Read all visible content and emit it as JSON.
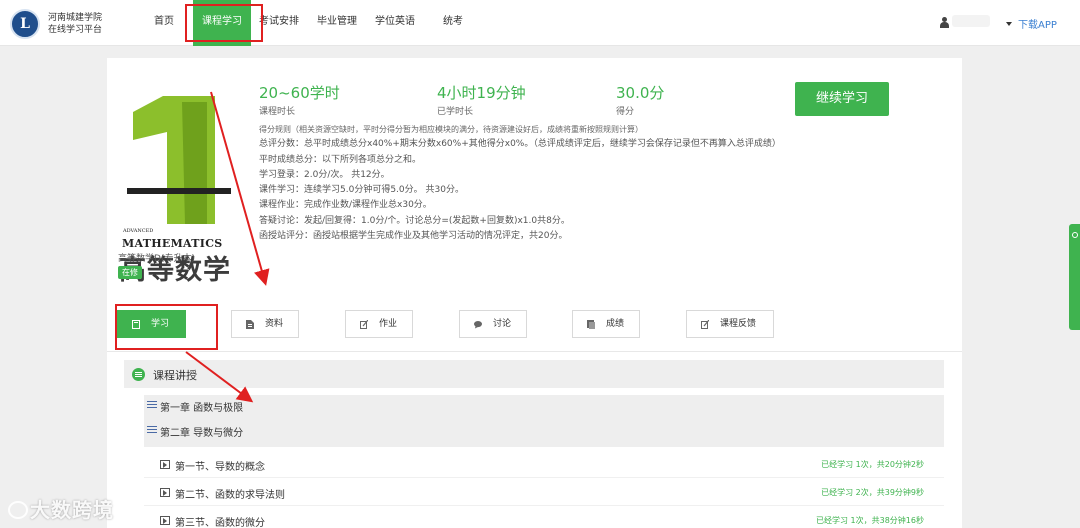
{
  "header": {
    "org_name": "河南城建学院",
    "org_sub": "在线学习平台",
    "nav": [
      {
        "label": "首页"
      },
      {
        "label": "课程学习"
      },
      {
        "label": "考试安排"
      },
      {
        "label": "毕业管理"
      },
      {
        "label": "学位英语"
      },
      {
        "label": "统考"
      }
    ],
    "active_nav": "课程学习",
    "download_app": "下载APP"
  },
  "course": {
    "cover_adv": "ADVANCED",
    "cover_math": "MATHEMATICS",
    "cover_title": "高等数学",
    "name": "高等数学D(专升本)",
    "status_badge": "在修",
    "stats": [
      {
        "value": "20~60学时",
        "label": "课程时长"
      },
      {
        "value": "4小时19分钟",
        "label": "已学时长"
      },
      {
        "value": "30.0分",
        "label": "得分"
      }
    ],
    "continue_label": "继续学习",
    "rules": [
      "得分规则（相关资源空缺时，平时分得分暂为相应模块的满分，待资源建设好后，成绩将重新按照规则计算）",
      "总评分数：总平时成绩总分x40%+期末分数x60%+其他得分x0%。（总评成绩评定后，继续学习会保存记录但不再算入总评成绩）",
      "平时成绩总分：以下所列各项总分之和。",
      "学习登录：2.0分/次。 共12分。",
      "课件学习：连续学习5.0分钟可得5.0分。 共30分。",
      "课程作业：完成作业数/课程作业总x30分。",
      "答疑讨论：发起/回复得：1.0分/个。讨论总分=(发起数+回复数)x1.0共8分。",
      "函授站评分：函授站根据学生完成作业及其他学习活动的情况评定，共20分。"
    ]
  },
  "tabs": [
    {
      "label": "学习",
      "icon": "book-icon"
    },
    {
      "label": "资料",
      "icon": "file-icon"
    },
    {
      "label": "作业",
      "icon": "edit-icon"
    },
    {
      "label": "讨论",
      "icon": "chat-icon"
    },
    {
      "label": "成绩",
      "icon": "grade-icon"
    },
    {
      "label": "课程反馈",
      "icon": "feedback-icon"
    }
  ],
  "active_tab": "学习",
  "syllabus": {
    "section_title": "课程讲授",
    "chapters": [
      {
        "title": "第一章 函数与极限"
      },
      {
        "title": "第二章 导数与微分"
      }
    ],
    "lessons": [
      {
        "title": "第一节、导数的概念",
        "status": "已经学习 1次，共20分钟2秒"
      },
      {
        "title": "第二节、函数的求导法则",
        "status": "已经学习 2次，共39分钟9秒"
      },
      {
        "title": "第三节、函数的微分",
        "status": "已经学习 1次，共38分钟16秒"
      }
    ]
  },
  "watermark": "大数跨境",
  "colors": {
    "brand_green": "#3fb34f",
    "annotation_red": "#e02020",
    "link_blue": "#3a7fd1"
  }
}
